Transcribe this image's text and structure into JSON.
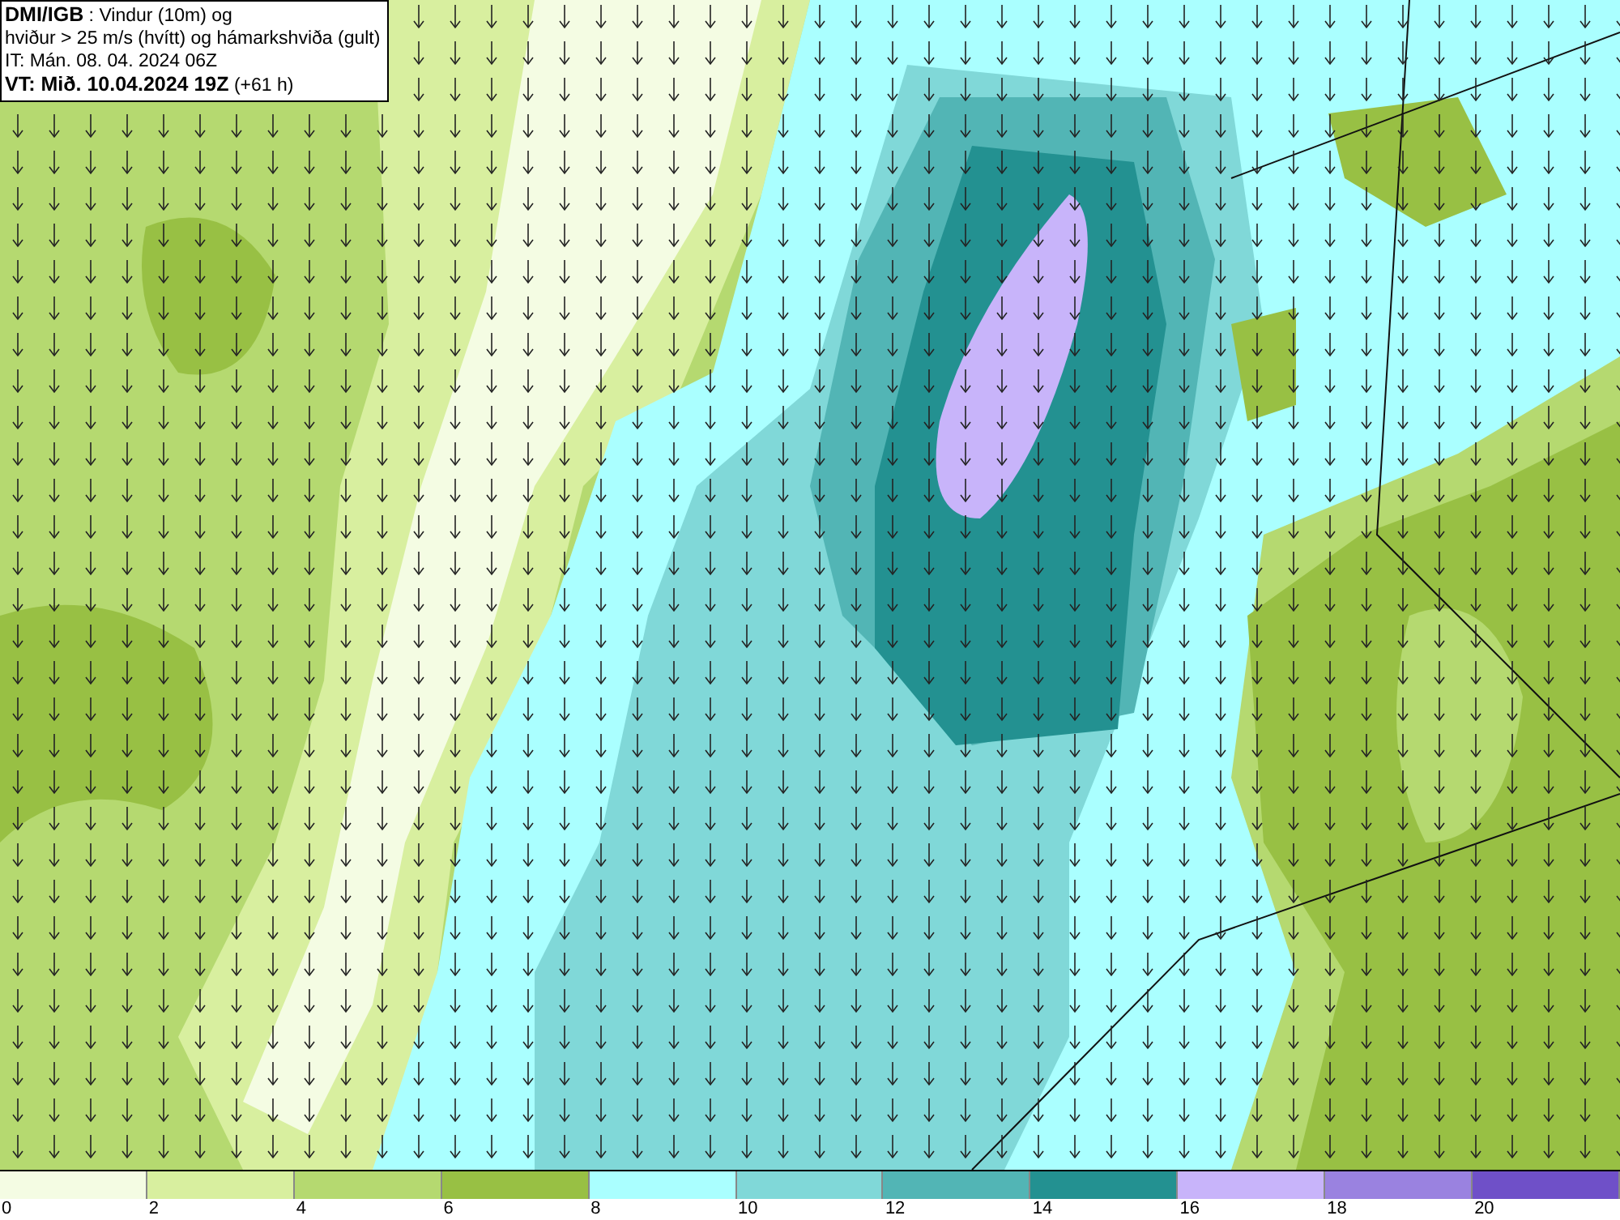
{
  "title_box": {
    "lines": [
      "**DMI/IGB** : Vindur (10m) og",
      "hviður > 25 m/s (hvítt) og hámarkshviða (gult)",
      "IT: Mán. 08. 04. 2024 06Z",
      "**VT: Mið. 10.04.2024 19Z** (+61 h)"
    ]
  },
  "legend": {
    "swatches": [
      {
        "color": "#f4fce3"
      },
      {
        "color": "#d8ef9f"
      },
      {
        "color": "#b5d970"
      },
      {
        "color": "#98c044"
      },
      {
        "color": "#aaffff"
      },
      {
        "color": "#80d8d8"
      },
      {
        "color": "#52b5b5"
      },
      {
        "color": "#239191"
      },
      {
        "color": "#c8b4fa"
      },
      {
        "color": "#9a82e0"
      },
      {
        "color": "#6f50c8"
      }
    ],
    "ticks": [
      "0",
      "2",
      "4",
      "6",
      "8",
      "10",
      "12",
      "14",
      "16",
      "18",
      "20"
    ]
  }
}
